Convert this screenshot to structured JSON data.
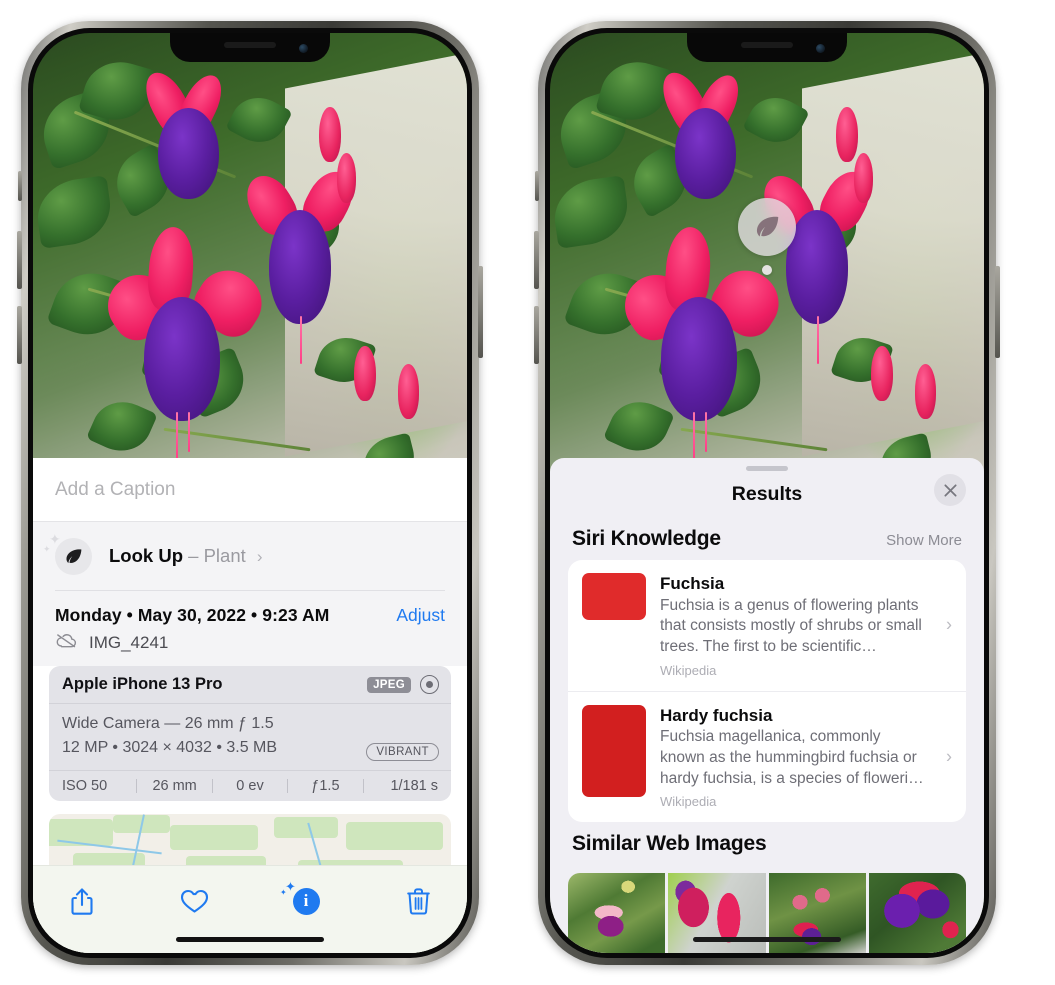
{
  "left_phone": {
    "name": "iPhone photo detail view",
    "caption_field": {
      "placeholder": "Add a Caption",
      "value": ""
    },
    "lookup": {
      "icon": "leaf-icon",
      "title": "Look Up",
      "dash": "–",
      "subject": "Plant",
      "chevron": "›"
    },
    "metadata": {
      "date": "Monday • May 30, 2022 • 9:23 AM",
      "adjust_label": "Adjust",
      "cloud_icon": "cloud-slash-icon",
      "filename": "IMG_4241"
    },
    "camera_card": {
      "device": "Apple iPhone 13 Pro",
      "format_badge": "JPEG",
      "raw_icon": "raw-circle-icon",
      "lens_line": "Wide Camera — 26 mm ƒ 1.5",
      "size_line": "12 MP • 3024 × 4032 • 3.5 MB",
      "style_badge": "VIBRANT",
      "exif": [
        "ISO 50",
        "26 mm",
        "0 ev",
        "ƒ1.5",
        "1/181 s"
      ]
    },
    "toolbar": {
      "share_label": "share-icon",
      "favorite_label": "heart-icon",
      "info_label": "info-sparkle-icon",
      "delete_label": "trash-icon"
    },
    "accent_color": "#1f7af0"
  },
  "right_phone": {
    "name": "Visual Look Up results view",
    "photo_badge": {
      "icon": "leaf-icon"
    },
    "sheet": {
      "title": "Results",
      "close_icon": "close-icon",
      "grabber": "drag-handle"
    },
    "siri_knowledge": {
      "section_title": "Siri Knowledge",
      "action": "Show More",
      "items": [
        {
          "title": "Fuchsia",
          "description": "Fuchsia is a genus of flowering plants that consists mostly of shrubs or small trees. The first to be scientific…",
          "source": "Wikipedia",
          "chevron": "›"
        },
        {
          "title": "Hardy fuchsia",
          "description": "Fuchsia magellanica, commonly known as the hummingbird fuchsia or hardy fuchsia, is a species of floweri…",
          "source": "Wikipedia",
          "chevron": "›"
        }
      ]
    },
    "similar_web_images": {
      "section_title": "Similar Web Images",
      "thumbs": [
        "web-image-1",
        "web-image-2",
        "web-image-3",
        "web-image-4"
      ]
    }
  }
}
